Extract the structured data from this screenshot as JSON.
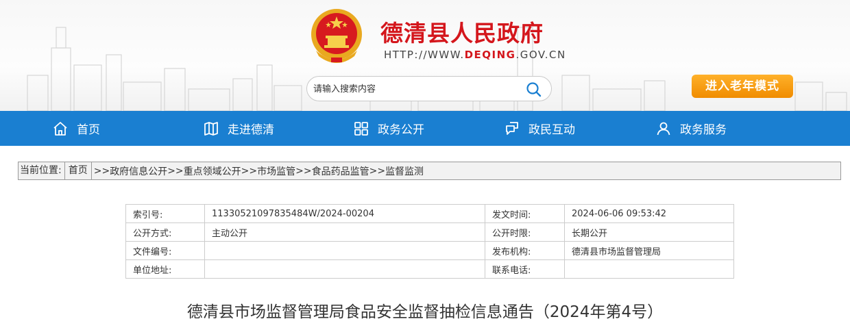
{
  "header": {
    "site_title": "德清县人民政府",
    "url_prefix": "HTTP://WWW.",
    "url_highlight": "DEQING",
    "url_suffix": ".GOV.CN",
    "search_placeholder": "请输入搜索内容",
    "elder_mode_label": "进入老年模式"
  },
  "nav": {
    "items": [
      {
        "label": "首页",
        "icon": "home-icon"
      },
      {
        "label": "走进德清",
        "icon": "map-icon"
      },
      {
        "label": "政务公开",
        "icon": "grid-icon"
      },
      {
        "label": "政民互动",
        "icon": "interaction-icon"
      },
      {
        "label": "政务服务",
        "icon": "user-icon"
      }
    ]
  },
  "breadcrumb": {
    "label": "当前位置:",
    "home": "首页",
    "items": [
      "政府信息公开",
      "重点领域公开",
      "市场监管",
      "食品药品监管",
      "监督监测"
    ],
    "separator": ">>"
  },
  "info_table": {
    "rows": [
      {
        "k1": "索引号:",
        "v1": "11330521097835484W/2024-00204",
        "k2": "发文时间:",
        "v2": "2024-06-06 09:53:42"
      },
      {
        "k1": "公开方式:",
        "v1": "主动公开",
        "k2": "公开时限:",
        "v2": "长期公开"
      },
      {
        "k1": "文件编号:",
        "v1": "",
        "k2": "发布机构:",
        "v2": "德清县市场监督管理局"
      },
      {
        "k1": "单位地址:",
        "v1": "",
        "k2": "联系电话:",
        "v2": ""
      }
    ]
  },
  "document": {
    "title": "德清县市场监督管理局食品安全监督抽检信息通告（2024年第4号）"
  },
  "colors": {
    "brand_red": "#d4161c",
    "nav_blue": "#1a7fd1",
    "elder_orange": "#f5a000"
  }
}
